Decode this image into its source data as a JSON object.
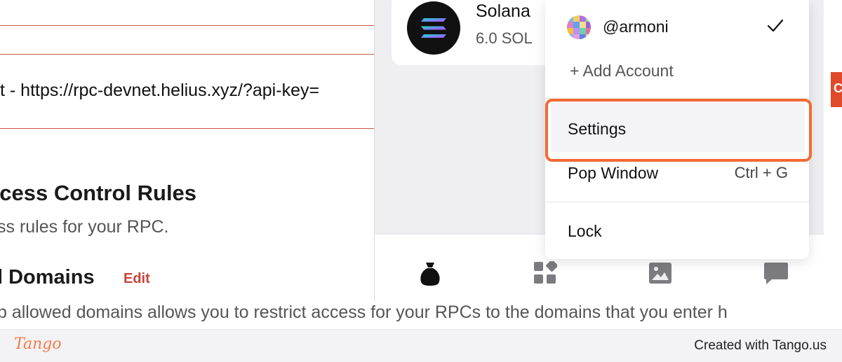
{
  "background_page": {
    "rpc_url": "t - https://rpc-devnet.helius.xyz/?api-key=",
    "access_control_title": "ccess Control Rules",
    "access_control_subtitle": "ss rules for your RPC.",
    "domains_title": "l Domains",
    "domains_edit": "Edit",
    "domains_description": "p allowed domains allows you to restrict access for your RPCs to the domains that you enter h",
    "side_tab_letter": "C"
  },
  "wallet": {
    "token": {
      "name": "Solana",
      "balance": "6.0 SOL",
      "icon": "solana-icon"
    },
    "bottom_nav": [
      {
        "icon": "tokens-bag-icon",
        "active": true
      },
      {
        "icon": "apps-grid-icon",
        "active": false
      },
      {
        "icon": "collectibles-image-icon",
        "active": false
      },
      {
        "icon": "messages-icon",
        "active": false
      }
    ]
  },
  "menu": {
    "account_name": "@armoni",
    "add_account": "+ Add Account",
    "settings": "Settings",
    "pop_window": "Pop Window",
    "pop_window_shortcut": "Ctrl + G",
    "lock": "Lock"
  },
  "highlight_color": "#f26a35",
  "footer": {
    "logo_text": "Tango",
    "created_with": "Created with Tango.us"
  }
}
